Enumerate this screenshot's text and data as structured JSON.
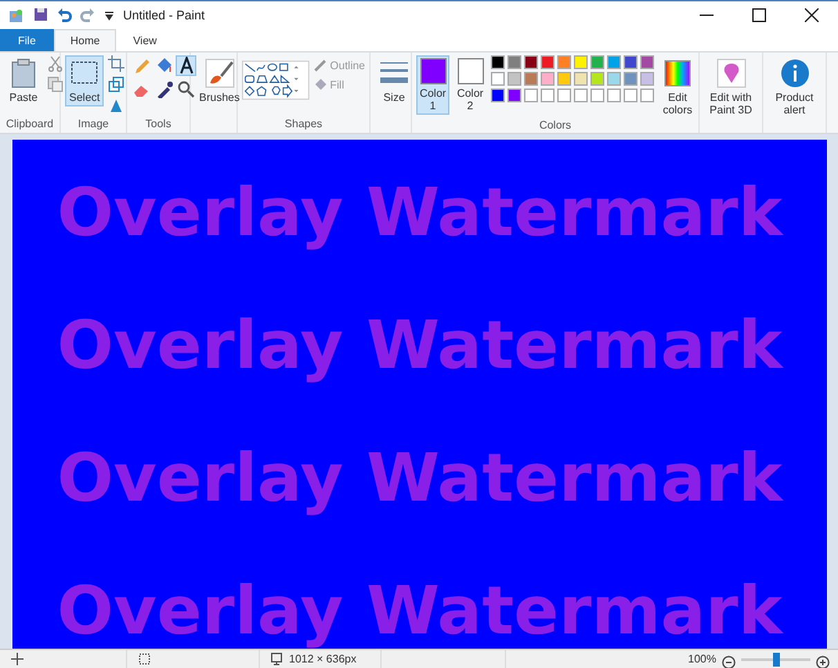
{
  "window": {
    "title": "Untitled - Paint"
  },
  "tabs": [
    {
      "label": "File",
      "kind": "file",
      "selected": false
    },
    {
      "label": "Home",
      "kind": "tab",
      "selected": true
    },
    {
      "label": "View",
      "kind": "tab",
      "selected": false
    }
  ],
  "clipboard": {
    "paste": "Paste",
    "label": "Clipboard"
  },
  "image": {
    "select": "Select",
    "select_selected": true,
    "label": "Image"
  },
  "tools": {
    "label": "Tools",
    "text_selected": true
  },
  "brushes": {
    "label": "Brushes"
  },
  "shapes": {
    "outline": "Outline",
    "fill": "Fill",
    "label": "Shapes"
  },
  "size": {
    "label": "Size"
  },
  "colors": {
    "label": "Colors",
    "slots": [
      {
        "label": "Color 1",
        "color": "#8000ff",
        "selected": true
      },
      {
        "label": "Color 2",
        "color": "#ffffff",
        "selected": false
      }
    ],
    "palette": [
      {
        "color": "#000000"
      },
      {
        "color": "#7f7f7f"
      },
      {
        "color": "#880015"
      },
      {
        "color": "#ed1c24"
      },
      {
        "color": "#ff7f27"
      },
      {
        "color": "#fff200"
      },
      {
        "color": "#22b14c"
      },
      {
        "color": "#00a2e8"
      },
      {
        "color": "#3f48cc"
      },
      {
        "color": "#a349a4"
      },
      {
        "color": "#ffffff"
      },
      {
        "color": "#c3c3c3"
      },
      {
        "color": "#b97a57"
      },
      {
        "color": "#ffaec9"
      },
      {
        "color": "#ffc90e"
      },
      {
        "color": "#efe4b0"
      },
      {
        "color": "#b5e61d"
      },
      {
        "color": "#99d9ea"
      },
      {
        "color": "#7092be"
      },
      {
        "color": "#c8bfe7"
      },
      {
        "color": "#0000ff"
      },
      {
        "color": "#8000ff"
      },
      {
        "color": "#ffffff"
      },
      {
        "color": "#ffffff"
      },
      {
        "color": "#ffffff"
      },
      {
        "color": "#ffffff"
      },
      {
        "color": "#ffffff"
      },
      {
        "color": "#ffffff"
      },
      {
        "color": "#ffffff"
      },
      {
        "color": "#ffffff"
      }
    ],
    "edit": "Edit colors"
  },
  "extra_buttons": [
    {
      "label": "Edit with Paint 3D",
      "kind": "paint3d"
    },
    {
      "label": "Product alert",
      "kind": "alert"
    }
  ],
  "canvas": {
    "color": "#0000ff",
    "lines": [
      {
        "text": "Overlay Watermark",
        "color": "#8a1fe8"
      },
      {
        "text": "Overlay Watermark",
        "color": "#8a1fe8"
      },
      {
        "text": "Overlay Watermark",
        "color": "#8a1fe8"
      },
      {
        "text": "Overlay Watermark",
        "color": "#8a1fe8"
      }
    ]
  },
  "status_bar": {
    "dimensions": "1012 × 636px",
    "zoom": "100%",
    "zoom_slider": {
      "level": 0.5
    }
  }
}
